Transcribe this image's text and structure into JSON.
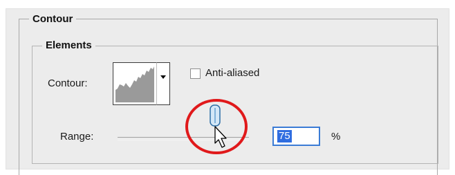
{
  "contour_section": {
    "title": "Contour"
  },
  "elements_group": {
    "title": "Elements",
    "contour_label": "Contour:",
    "anti_aliased": {
      "label": "Anti-aliased",
      "checked": false
    },
    "range": {
      "label": "Range:",
      "value": "75",
      "unit": "%"
    }
  },
  "icons": [
    "chevron-down-icon",
    "contour-curve-icon",
    "slider-thumb-icon",
    "mouse-pointer-icon"
  ],
  "colors": {
    "highlight_circle": "#e0191b",
    "selection_blue": "#2f6de0",
    "input_border": "#3a7bd5"
  }
}
